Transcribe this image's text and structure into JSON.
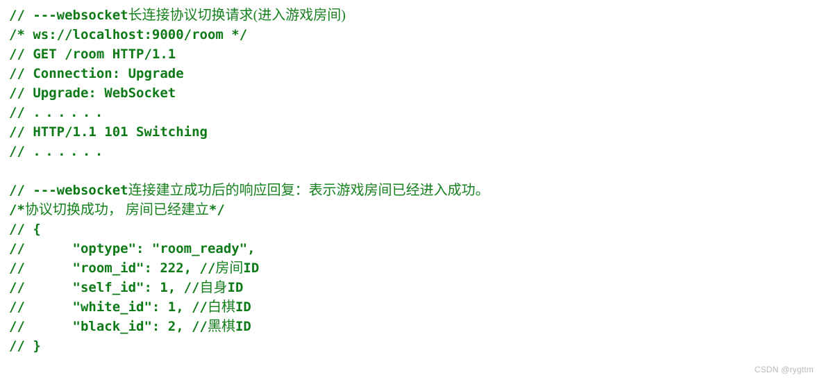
{
  "page": {
    "background_color": "#ffffff",
    "text_color_latin": "#0d7a17",
    "text_color_cjk": "#17801f",
    "watermark_color": "#b9b9b9"
  },
  "watermark": {
    "text": "CSDN @rygttm"
  },
  "code": {
    "language": "javascript-comment",
    "lines": [
      {
        "id": "line-1",
        "kind": "comment",
        "segments": [
          {
            "type": "latin",
            "text": "// ---websocket"
          },
          {
            "type": "cjk",
            "text": "长连接协议切换请求(进入游戏房间)"
          }
        ],
        "plain": "// ---websocket长连接协议切换请求(进入游戏房间)"
      },
      {
        "id": "line-2",
        "kind": "block-comment",
        "segments": [
          {
            "type": "latin",
            "text": "/* ws://localhost:9000/room */"
          }
        ],
        "plain": "/* ws://localhost:9000/room */"
      },
      {
        "id": "line-3",
        "kind": "comment",
        "segments": [
          {
            "type": "latin",
            "text": "// GET /room HTTP/1.1"
          }
        ],
        "plain": "// GET /room HTTP/1.1"
      },
      {
        "id": "line-4",
        "kind": "comment",
        "segments": [
          {
            "type": "latin",
            "text": "// Connection: Upgrade"
          }
        ],
        "plain": "// Connection: Upgrade"
      },
      {
        "id": "line-5",
        "kind": "comment",
        "segments": [
          {
            "type": "latin",
            "text": "// Upgrade: WebSocket"
          }
        ],
        "plain": "// Upgrade: WebSocket"
      },
      {
        "id": "line-6",
        "kind": "comment-ellipsis",
        "segments": [
          {
            "type": "latin",
            "text": "// "
          },
          {
            "type": "dots",
            "text": "......"
          }
        ],
        "plain": "// ......"
      },
      {
        "id": "line-7",
        "kind": "comment",
        "segments": [
          {
            "type": "latin",
            "text": "// HTTP/1.1 101 Switching"
          }
        ],
        "plain": "// HTTP/1.1 101 Switching"
      },
      {
        "id": "line-8",
        "kind": "comment-ellipsis",
        "segments": [
          {
            "type": "latin",
            "text": "// "
          },
          {
            "type": "dots",
            "text": "......"
          }
        ],
        "plain": "// ......"
      },
      {
        "id": "line-9",
        "kind": "blank",
        "segments": [],
        "plain": ""
      },
      {
        "id": "line-10",
        "kind": "comment",
        "segments": [
          {
            "type": "latin",
            "text": "// ---websocket"
          },
          {
            "type": "cjk",
            "text": "连接建立成功后的响应回复：表示游戏房间已经进入成功。"
          }
        ],
        "plain": "// ---websocket连接建立成功后的响应回复：表示游戏房间已经进入成功。"
      },
      {
        "id": "line-11",
        "kind": "block-comment",
        "segments": [
          {
            "type": "latin",
            "text": "/*"
          },
          {
            "type": "cjk",
            "text": "协议切换成功， 房间已经建立"
          },
          {
            "type": "latin",
            "text": "*/"
          }
        ],
        "plain": "/*协议切换成功， 房间已经建立*/"
      },
      {
        "id": "line-12",
        "kind": "comment",
        "segments": [
          {
            "type": "latin",
            "text": "// {"
          }
        ],
        "plain": "// {"
      },
      {
        "id": "line-13",
        "kind": "comment-json",
        "segments": [
          {
            "type": "latin",
            "text": "//      \"optype\": \"room_ready\","
          }
        ],
        "plain": "//      \"optype\": \"room_ready\","
      },
      {
        "id": "line-14",
        "kind": "comment-json",
        "segments": [
          {
            "type": "latin",
            "text": "//      \"room_id\": 222, //"
          },
          {
            "type": "cjk",
            "text": "房间"
          },
          {
            "type": "latin",
            "text": "ID"
          }
        ],
        "plain": "//      \"room_id\": 222, //房间ID"
      },
      {
        "id": "line-15",
        "kind": "comment-json",
        "segments": [
          {
            "type": "latin",
            "text": "//      \"self_id\": 1, //"
          },
          {
            "type": "cjk",
            "text": "自身"
          },
          {
            "type": "latin",
            "text": "ID"
          }
        ],
        "plain": "//      \"self_id\": 1, //自身ID"
      },
      {
        "id": "line-16",
        "kind": "comment-json",
        "segments": [
          {
            "type": "latin",
            "text": "//      \"white_id\": 1, //"
          },
          {
            "type": "cjk",
            "text": "白棋"
          },
          {
            "type": "latin",
            "text": "ID"
          }
        ],
        "plain": "//      \"white_id\": 1, //白棋ID"
      },
      {
        "id": "line-17",
        "kind": "comment-json",
        "segments": [
          {
            "type": "latin",
            "text": "//      \"black_id\": 2, //"
          },
          {
            "type": "cjk",
            "text": "黑棋"
          },
          {
            "type": "latin",
            "text": "ID"
          }
        ],
        "plain": "//      \"black_id\": 2, //黑棋ID"
      },
      {
        "id": "line-18",
        "kind": "comment",
        "segments": [
          {
            "type": "latin",
            "text": "// }"
          }
        ],
        "plain": "// }"
      }
    ]
  },
  "payload": {
    "optype": "room_ready",
    "room_id": 222,
    "self_id": 1,
    "white_id": 1,
    "black_id": 2
  },
  "handshake": {
    "url": "ws://localhost:9000/room",
    "request_line": "GET /room HTTP/1.1",
    "headers": [
      "Connection: Upgrade",
      "Upgrade: WebSocket"
    ],
    "response_line": "HTTP/1.1 101 Switching"
  }
}
